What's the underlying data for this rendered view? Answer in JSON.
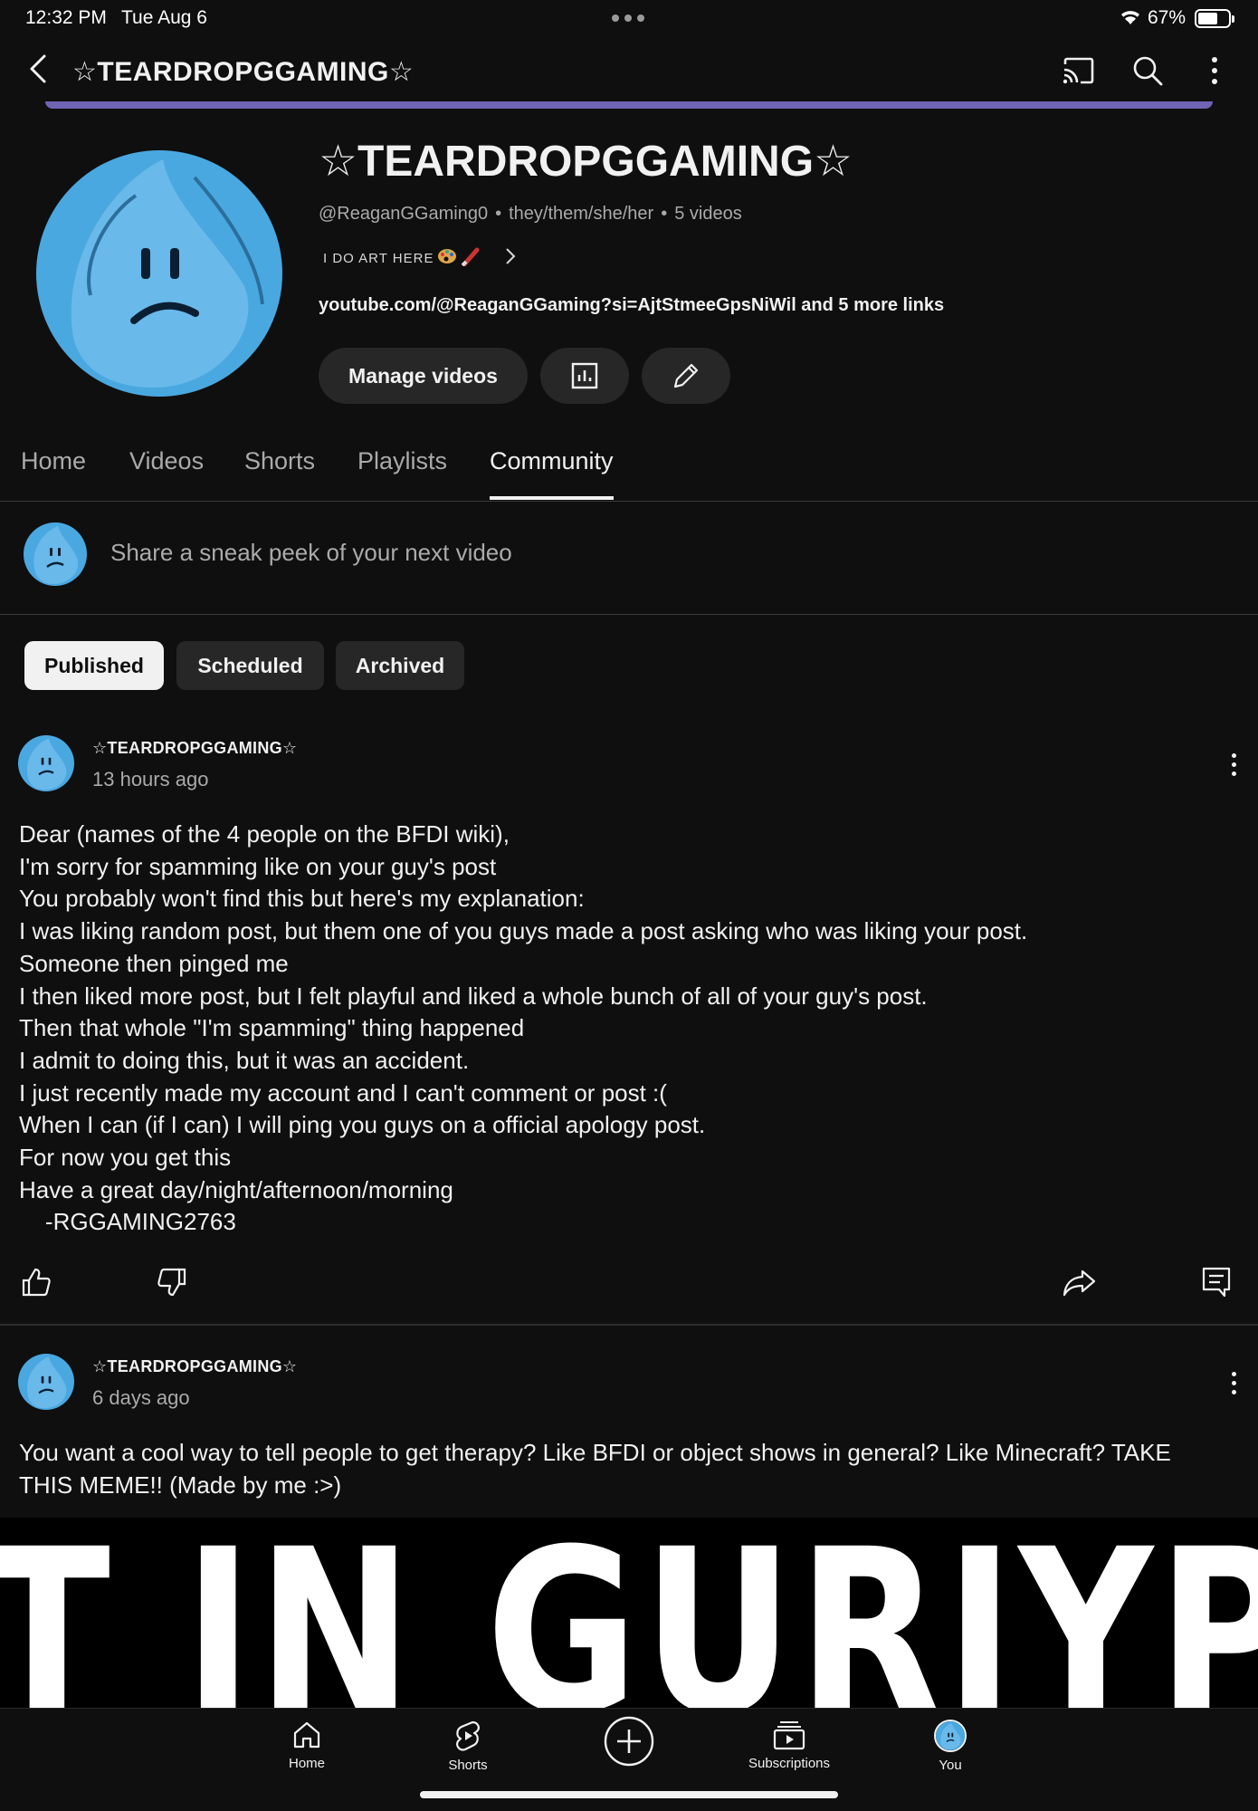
{
  "status_bar": {
    "time": "12:32 PM",
    "date": "Tue Aug 6",
    "battery": "67%",
    "battery_level": 0.67
  },
  "app_bar": {
    "title": "☆TEARDROPGGAMING☆",
    "icons": [
      "back-icon",
      "cast-icon",
      "search-icon",
      "more-vertical-icon"
    ]
  },
  "channel": {
    "name": "☆TEARDROPGGAMING☆",
    "handle": "@ReaganGGaming0",
    "pronouns": "they/them/she/her",
    "video_count": "5 videos",
    "description": "I DO ART HERE",
    "links": "youtube.com/@ReaganGGaming?si=AjtStmeeGpsNiWil and 5 more links",
    "manage_videos_label": "Manage videos",
    "colors": {
      "avatar_blue": "#4aa8e0",
      "banner": "#7b6ec6"
    }
  },
  "tabs": [
    {
      "label": "Home"
    },
    {
      "label": "Videos"
    },
    {
      "label": "Shorts"
    },
    {
      "label": "Playlists"
    },
    {
      "label": "Community",
      "selected": true
    }
  ],
  "composer": {
    "placeholder": "Share a sneak peek of your next video"
  },
  "filters": [
    {
      "label": "Published",
      "selected": true
    },
    {
      "label": "Scheduled"
    },
    {
      "label": "Archived"
    }
  ],
  "posts": [
    {
      "author": "☆TEARDROPGGAMING☆",
      "time": "13 hours ago",
      "body": "Dear (names of the 4 people on the BFDI wiki),\nI'm sorry for spamming like on your guy's post\nYou probably won't find this but here's my explanation:\nI was liking random post, but them one of you guys made a post asking who was liking your post.\nSomeone then pinged me\nI then liked more post, but I felt playful and liked a whole bunch of all of your guy's post.\nThen that whole \"I'm spamming\" thing happened\nI admit to doing this, but it was an accident.\nI just recently made my account and I can't comment or post :(\nWhen I can (if I can) I will ping you guys on a official apology post.\nFor now you get this\nHave a great day/night/afternoon/morning\n    -RGGAMING2763"
    },
    {
      "author": "☆TEARDROPGGAMING☆",
      "time": "6 days ago",
      "body": "You want a cool way to tell people to get therapy? Like BFDI or object shows in general? Like Minecraft? TAKE\nTHIS MEME!! (Made by me :>)",
      "image_text": "T IN GURIYPO"
    }
  ],
  "bottom_nav": [
    {
      "label": "Home",
      "icon": "home-icon"
    },
    {
      "label": "Shorts",
      "icon": "shorts-icon"
    },
    {
      "label": "",
      "icon": "create-plus-icon"
    },
    {
      "label": "Subscriptions",
      "icon": "subscriptions-icon"
    },
    {
      "label": "You",
      "icon": "avatar"
    }
  ]
}
